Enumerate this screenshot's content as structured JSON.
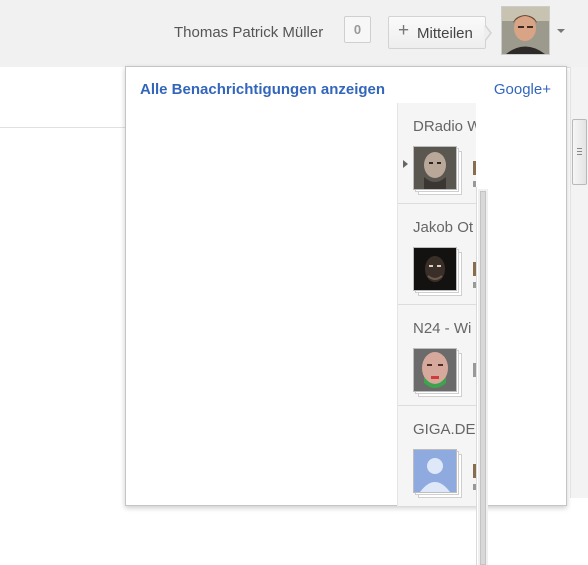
{
  "header": {
    "user_name": "Thomas Patrick Müller",
    "notification_count": "0",
    "share_button": {
      "icon": "plus-icon",
      "label": "Mitteilen"
    },
    "avatar": "profile-photo",
    "menu_icon": "caret-down-icon"
  },
  "notifications_panel": {
    "show_all_link": "Alle Benachrichtigungen anzeigen",
    "gplus_link": "Google+",
    "items": [
      {
        "title": "DRadio W",
        "avatar": "bald-man-photo"
      },
      {
        "title": "Jakob Ot",
        "avatar": "dark-portrait-photo"
      },
      {
        "title": "N24 - Wi",
        "avatar": "face-graphic-photo"
      },
      {
        "title": "GIGA.DE",
        "avatar": "default-profile-silhouette"
      }
    ]
  },
  "colors": {
    "link": "#3366bb",
    "topbar": "#f1f1f1"
  }
}
